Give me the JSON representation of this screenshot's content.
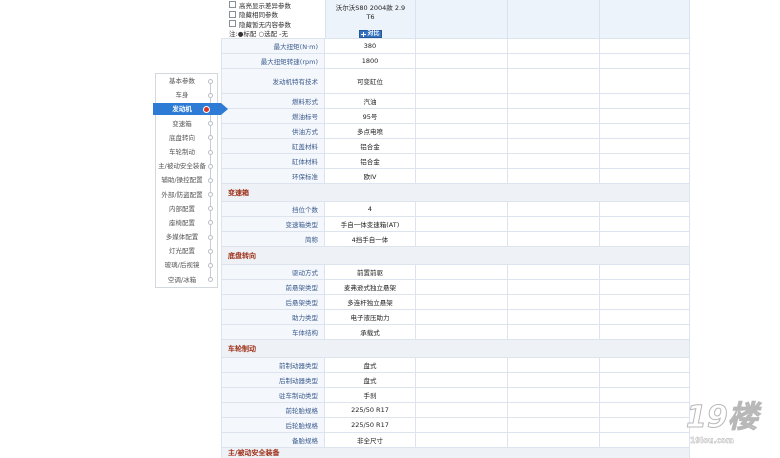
{
  "options": {
    "checkboxes": [
      {
        "label": "高亮显示差异参数",
        "checked": false
      },
      {
        "label": "隐藏相同参数",
        "checked": false
      },
      {
        "label": "隐藏暂无内容参数",
        "checked": false
      }
    ],
    "legend_note": "注:●标配 ○选配 -无"
  },
  "car": {
    "name_lines": [
      "沃尔沃S80 2004款 2.9",
      "T6"
    ],
    "compare_icon": "plus-icon",
    "compare_button": "对比"
  },
  "nav": {
    "active_index": 2,
    "items": [
      "基本参数",
      "车身",
      "发动机",
      "变速箱",
      "底盘转向",
      "车轮制动",
      "主/被动安全装备",
      "辅助/操控配置",
      "外部/防盗配置",
      "内部配置",
      "座椅配置",
      "多媒体配置",
      "灯光配置",
      "玻璃/后视镜",
      "空调/冰箱"
    ]
  },
  "table": {
    "groups": [
      {
        "rows": [
          {
            "label": "最大扭矩(N·m)",
            "value": "380"
          },
          {
            "label": "最大扭矩转速(rpm)",
            "value": "1800"
          },
          {
            "label": "发动机特有技术",
            "value": "可变缸位"
          },
          {
            "label": "燃料形式",
            "value": "汽油"
          },
          {
            "label": "燃油标号",
            "value": "95号"
          },
          {
            "label": "供油方式",
            "value": "多点电喷"
          },
          {
            "label": "缸盖材料",
            "value": "铝合金"
          },
          {
            "label": "缸体材料",
            "value": "铝合金"
          },
          {
            "label": "环保标准",
            "value": "欧IV"
          }
        ]
      },
      {
        "title": "变速箱",
        "rows": [
          {
            "label": "挡位个数",
            "value": "4"
          },
          {
            "label": "变速箱类型",
            "value": "手自一体变速箱(AT)"
          },
          {
            "label": "简称",
            "value": "4挡手自一体"
          }
        ]
      },
      {
        "title": "底盘转向",
        "rows": [
          {
            "label": "驱动方式",
            "value": "前置前驱"
          },
          {
            "label": "前悬架类型",
            "value": "麦弗逊式独立悬架"
          },
          {
            "label": "后悬架类型",
            "value": "多连杆独立悬架"
          },
          {
            "label": "助力类型",
            "value": "电子液压助力"
          },
          {
            "label": "车体结构",
            "value": "承载式"
          }
        ]
      },
      {
        "title": "车轮制动",
        "rows": [
          {
            "label": "前制动器类型",
            "value": "盘式"
          },
          {
            "label": "后制动器类型",
            "value": "盘式"
          },
          {
            "label": "驻车制动类型",
            "value": "手刹"
          },
          {
            "label": "前轮胎规格",
            "value": "225/50 R17"
          },
          {
            "label": "后轮胎规格",
            "value": "225/50 R17"
          },
          {
            "label": "备胎规格",
            "value": "非全尺寸"
          }
        ]
      },
      {
        "title": "主/被动安全装备",
        "rows": []
      }
    ]
  },
  "watermark": {
    "logo": "19楼",
    "site": "19lou.com"
  },
  "colors": {
    "nav_active": "#2d7bd4",
    "nav_active_dot": "#d8352a",
    "section_title": "#9e3119",
    "label_text": "#3b5b8f",
    "compare_button": "#3572c0",
    "header_bg": "#edf3fa"
  }
}
